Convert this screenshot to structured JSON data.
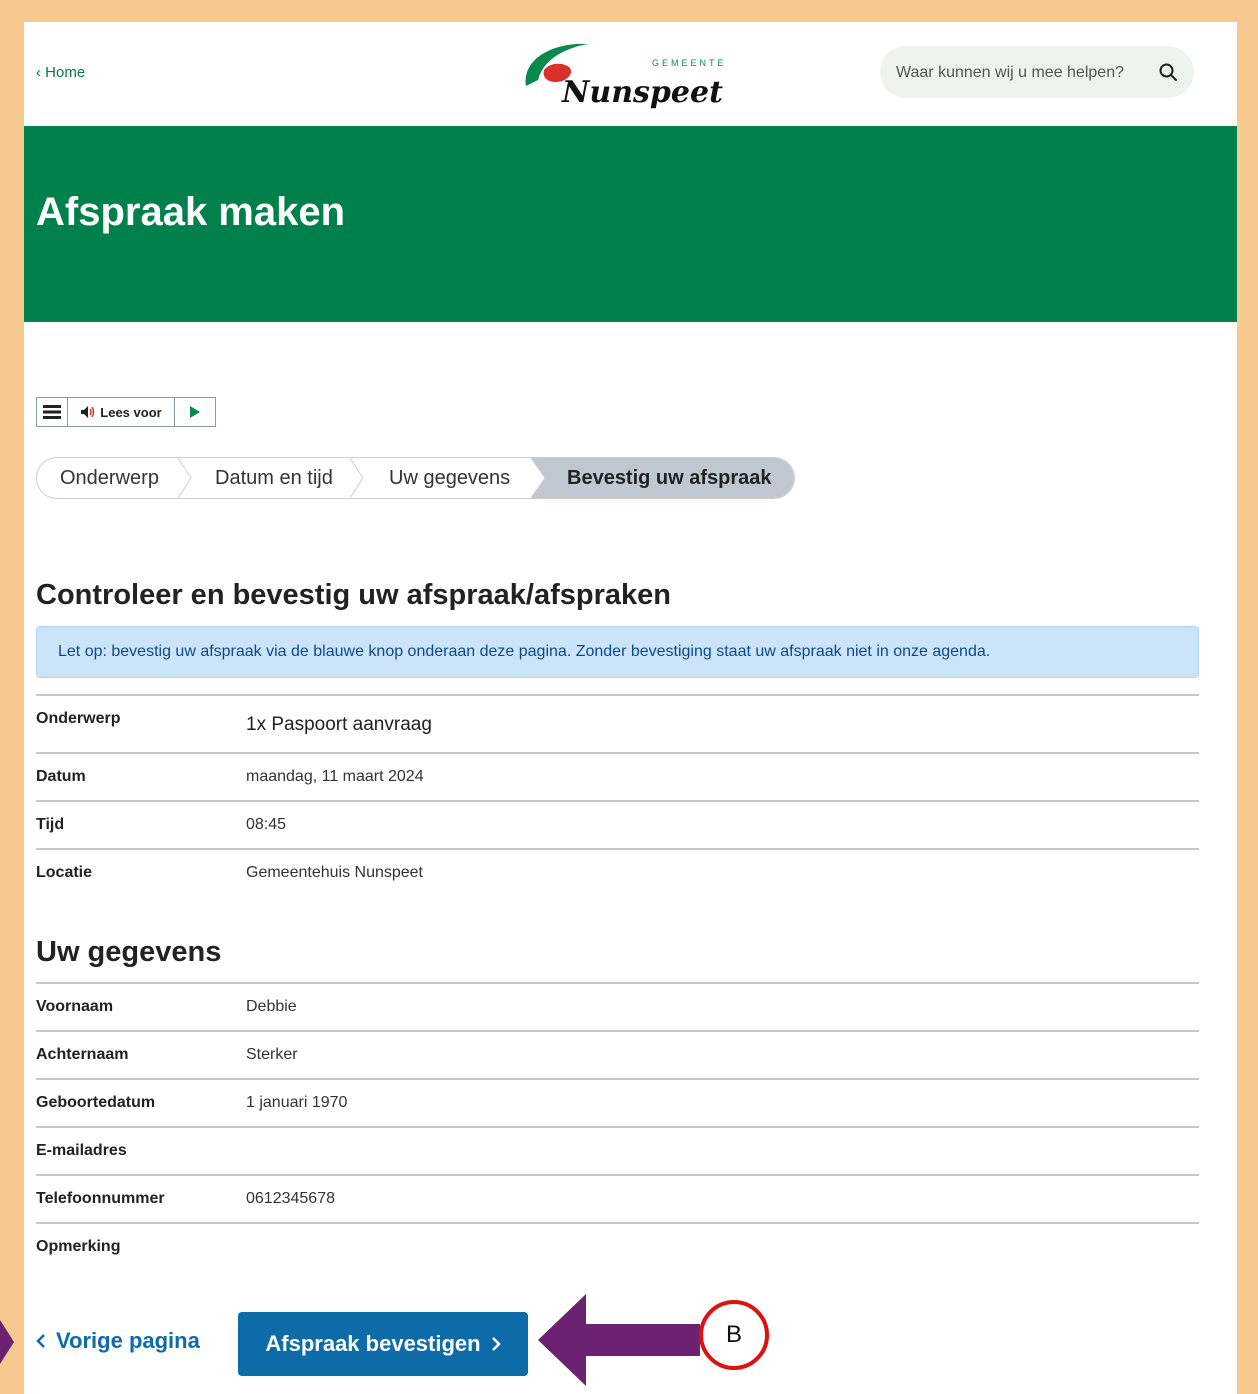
{
  "header": {
    "home_link": "‹ Home",
    "logo": {
      "top_text": "GEMEENTE",
      "name": "Nunspeet"
    },
    "search": {
      "placeholder": "Waar kunnen wij u mee helpen?",
      "icon": "search-icon"
    }
  },
  "banner": {
    "title": "Afspraak maken"
  },
  "readspeaker": {
    "listen_label": "Lees voor",
    "icons": [
      "menu-icon",
      "speaker-icon",
      "play-icon"
    ]
  },
  "steps": [
    {
      "label": "Onderwerp",
      "active": false
    },
    {
      "label": "Datum en tijd",
      "active": false
    },
    {
      "label": "Uw gegevens",
      "active": false
    },
    {
      "label": "Bevestig uw afspraak",
      "active": true
    }
  ],
  "confirm_section": {
    "heading": "Controleer en bevestig uw afspraak/afspraken",
    "notice": "Let op: bevestig uw afspraak via de blauwe knop onderaan deze pagina. Zonder bevestiging staat uw afspraak niet in onze agenda.",
    "rows": [
      {
        "label": "Onderwerp",
        "value": "1x Paspoort aanvraag"
      },
      {
        "label": "Datum",
        "value": "maandag, 11 maart 2024"
      },
      {
        "label": "Tijd",
        "value": "08:45"
      },
      {
        "label": "Locatie",
        "value": "Gemeentehuis Nunspeet"
      }
    ]
  },
  "details_section": {
    "heading": "Uw gegevens",
    "rows": [
      {
        "label": "Voornaam",
        "value": "Debbie"
      },
      {
        "label": "Achternaam",
        "value": "Sterker"
      },
      {
        "label": "Geboortedatum",
        "value": "1 januari 1970"
      },
      {
        "label": "E-mailadres",
        "value": ""
      },
      {
        "label": "Telefoonnummer",
        "value": "0612345678"
      },
      {
        "label": "Opmerking",
        "value": ""
      }
    ]
  },
  "actions": {
    "previous_label": "Vorige pagina",
    "confirm_label": "Afspraak bevestigen"
  },
  "annotation": {
    "marker_label": "B"
  },
  "colors": {
    "brand_green": "#00804a",
    "button_blue": "#0d6ca8",
    "notice_bg": "#cce4f9",
    "annotation_purple": "#6b2270",
    "annotation_red": "#e01010",
    "page_border": "#f6c98e"
  }
}
